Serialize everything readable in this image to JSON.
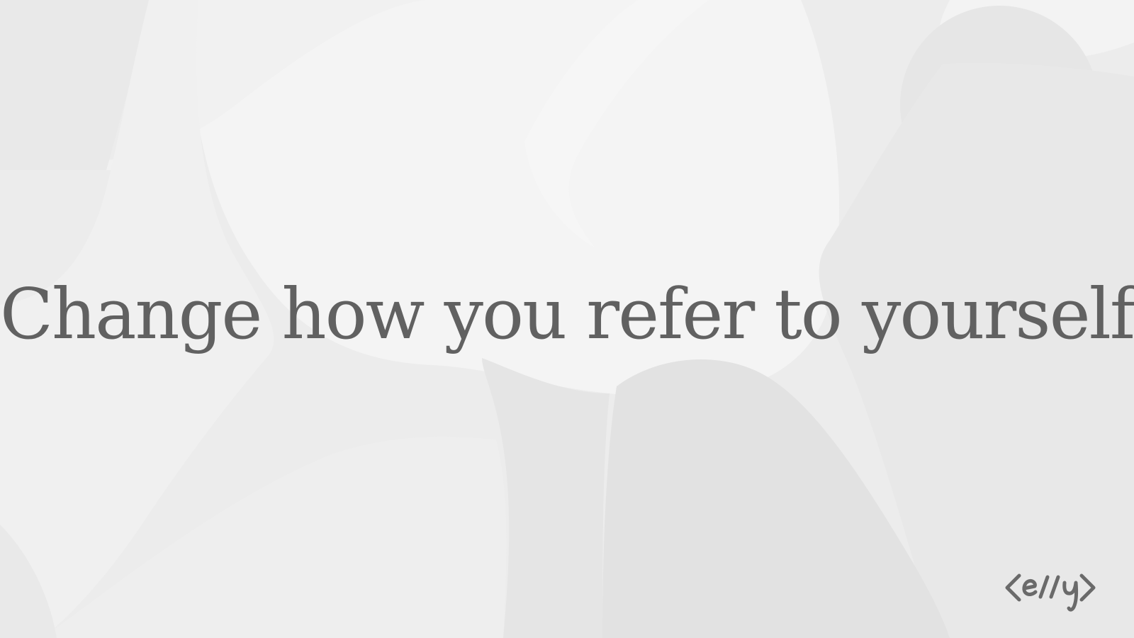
{
  "headline": "Change how you refer to yourself",
  "logo": {
    "text": "<e//y>",
    "icon": "code-brackets-logo-icon"
  },
  "colors": {
    "background": "#ececec",
    "text": "#616161",
    "logo": "#6a6a6a"
  }
}
